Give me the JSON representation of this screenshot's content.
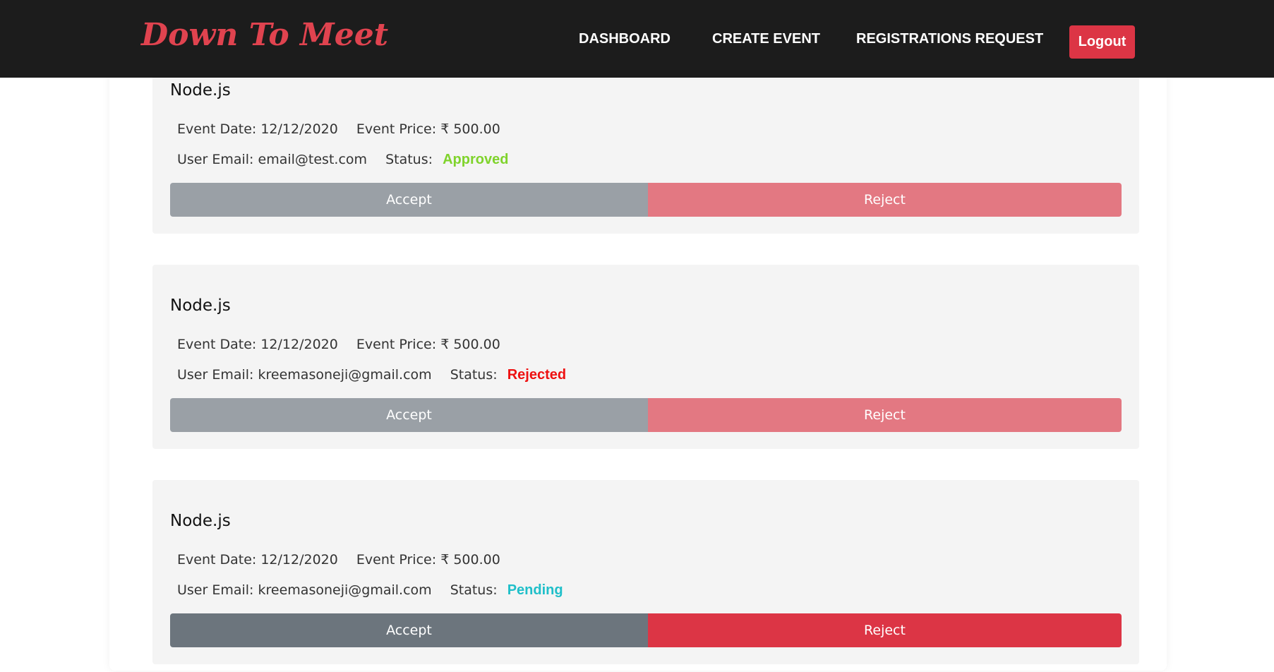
{
  "navbar": {
    "brand": "Down To Meet",
    "links": [
      "DASHBOARD",
      "CREATE EVENT",
      "REGISTRATIONS REQUEST"
    ],
    "logout_label": "Logout"
  },
  "colors": {
    "brand": "#e0434f",
    "approved": "#7fd32b",
    "rejected": "#ee1111",
    "pending": "#1fbfc9"
  },
  "requests": [
    {
      "title": "Node.js",
      "date_label": "Event Date:",
      "date": "12/12/2020",
      "price_label": "Event Price:",
      "price": "₹ 500.00",
      "email_label": "User Email:",
      "email": "email@test.com",
      "status_label": "Status:",
      "status": "Approved",
      "accept_label": "Accept",
      "reject_label": "Reject"
    },
    {
      "title": "Node.js",
      "date_label": "Event Date:",
      "date": "12/12/2020",
      "price_label": "Event Price:",
      "price": "₹ 500.00",
      "email_label": "User Email:",
      "email": "kreemasoneji@gmail.com",
      "status_label": "Status:",
      "status": "Rejected",
      "accept_label": "Accept",
      "reject_label": "Reject"
    },
    {
      "title": "Node.js",
      "date_label": "Event Date:",
      "date": "12/12/2020",
      "price_label": "Event Price:",
      "price": "₹ 500.00",
      "email_label": "User Email:",
      "email": "kreemasoneji@gmail.com",
      "status_label": "Status:",
      "status": "Pending",
      "accept_label": "Accept",
      "reject_label": "Reject"
    }
  ]
}
